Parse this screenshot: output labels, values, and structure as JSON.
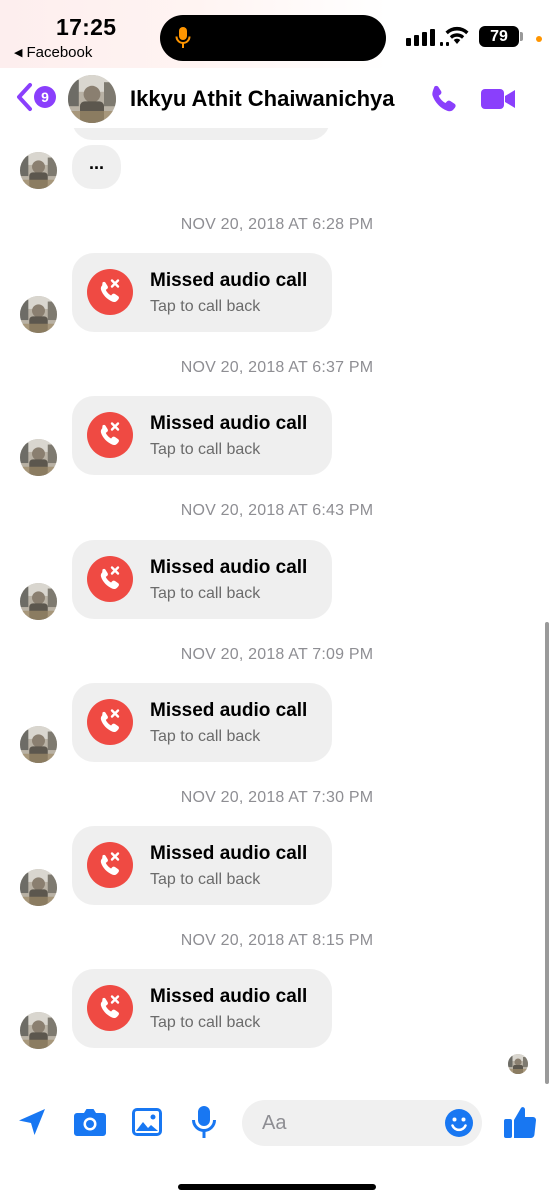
{
  "status_bar": {
    "time": "17:25",
    "back_app_label": "Facebook",
    "battery": "79"
  },
  "header": {
    "unread_count": "9",
    "contact_name": "Ikkyu Athit Chaiwanichya",
    "accent_color": "#8a3ffc"
  },
  "messages": {
    "typing_text": "...",
    "calls": [
      {
        "timestamp": "NOV 20, 2018 AT 6:28 PM",
        "title": "Missed audio call",
        "subtitle": "Tap to call back"
      },
      {
        "timestamp": "NOV 20, 2018 AT 6:37 PM",
        "title": "Missed audio call",
        "subtitle": "Tap to call back"
      },
      {
        "timestamp": "NOV 20, 2018 AT 6:43 PM",
        "title": "Missed audio call",
        "subtitle": "Tap to call back"
      },
      {
        "timestamp": "NOV 20, 2018 AT 7:09 PM",
        "title": "Missed audio call",
        "subtitle": "Tap to call back"
      },
      {
        "timestamp": "NOV 20, 2018 AT 7:30 PM",
        "title": "Missed audio call",
        "subtitle": "Tap to call back"
      },
      {
        "timestamp": "NOV 20, 2018 AT 8:15 PM",
        "title": "Missed audio call",
        "subtitle": "Tap to call back"
      }
    ],
    "missed_call_color": "#ef4a43"
  },
  "composer": {
    "placeholder": "Aa",
    "tool_color": "#1877f2",
    "tools": [
      "location-arrow-icon",
      "camera-icon",
      "image-icon",
      "microphone-icon"
    ]
  }
}
